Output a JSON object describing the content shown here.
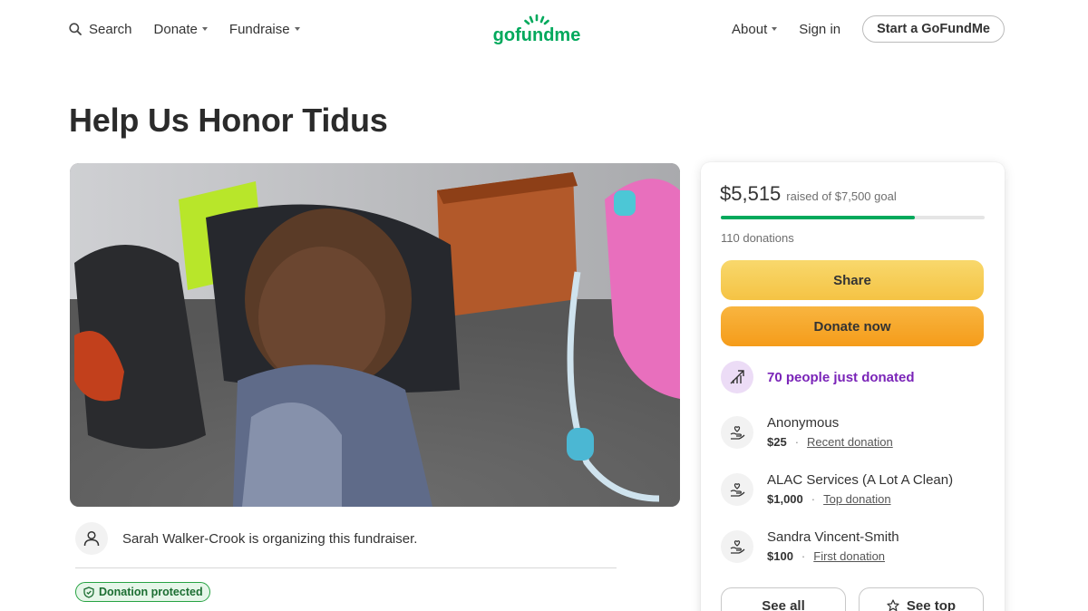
{
  "header": {
    "search_label": "Search",
    "donate_label": "Donate",
    "fundraise_label": "Fundraise",
    "logo_text": "gofundme",
    "about_label": "About",
    "signin_label": "Sign in",
    "start_label": "Start a GoFundMe"
  },
  "campaign": {
    "title": "Help Us Honor Tidus",
    "organizer_text": "Sarah Walker-Crook is organizing this fundraiser.",
    "protected_label": "Donation protected"
  },
  "panel": {
    "raised_amount": "$5,515",
    "goal_text": "raised of $7,500 goal",
    "progress_fraction": 0.735,
    "donations_count": "110 donations",
    "share_label": "Share",
    "donate_label": "Donate now",
    "trend_text": "70 people just donated",
    "donors": [
      {
        "name": "Anonymous",
        "amount": "$25",
        "tag": "Recent donation"
      },
      {
        "name": "ALAC Services (A Lot A Clean)",
        "amount": "$1,000",
        "tag": "Top donation"
      },
      {
        "name": "Sandra Vincent-Smith",
        "amount": "$100",
        "tag": "First donation"
      }
    ],
    "see_all_label": "See all",
    "see_top_label": "See top"
  },
  "colors": {
    "brand_green": "#02a95c",
    "share_yellow": "#f5c344",
    "donate_orange": "#f59c1a",
    "trend_purple": "#7a24b8"
  }
}
